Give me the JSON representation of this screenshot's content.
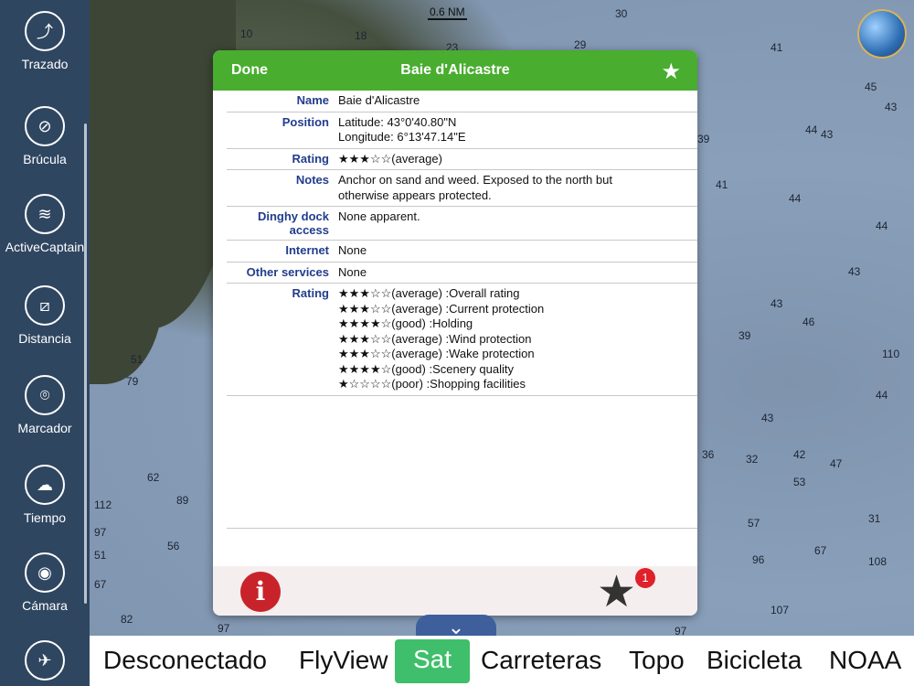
{
  "sidebar": {
    "items": [
      {
        "icon": "route-icon",
        "glyph": "⤴",
        "label": "Trazado"
      },
      {
        "icon": "compass-icon",
        "glyph": "⊘",
        "label": "Brúcula"
      },
      {
        "icon": "activecaptain-icon",
        "glyph": "≋",
        "label": "ActiveCaptain"
      },
      {
        "icon": "ruler-icon",
        "glyph": "⧄",
        "label": "Distancia"
      },
      {
        "icon": "pin-icon",
        "glyph": "⌾",
        "label": "Marcador"
      },
      {
        "icon": "weather-icon",
        "glyph": "☁",
        "label": "Tiempo"
      },
      {
        "icon": "camera-icon",
        "glyph": "◉",
        "label": "Cámara"
      },
      {
        "icon": "satellite-icon",
        "glyph": "✈",
        "label": ""
      }
    ]
  },
  "map": {
    "scale_label": "0.6 NM",
    "depths": [
      "30",
      "10",
      "18",
      "23",
      "29",
      "41",
      "43",
      "39",
      "43",
      "41",
      "44",
      "44",
      "43",
      "43",
      "46",
      "39",
      "44",
      "43",
      "42",
      "36",
      "32",
      "53",
      "47",
      "57",
      "67",
      "31",
      "51",
      "79",
      "62",
      "89",
      "112",
      "97",
      "56",
      "51",
      "67",
      "82",
      "97",
      "97",
      "96",
      "108",
      "107",
      "110",
      "45",
      "44"
    ]
  },
  "dialog": {
    "done_label": "Done",
    "title": "Baie d'Alicastre",
    "rows": [
      {
        "key": "Name",
        "lines": [
          "Baie d'Alicastre"
        ]
      },
      {
        "key": "Position",
        "lines": [
          "Latitude: 43°0'40.80\"N",
          "Longitude: 6°13'47.14\"E"
        ]
      },
      {
        "key": "Rating",
        "lines": [
          "★★★☆☆(average)"
        ]
      },
      {
        "key": "Notes",
        "lines": [
          "Anchor on sand and weed.  Exposed to the north but",
          "otherwise appears protected."
        ]
      },
      {
        "key": "Dinghy dock access",
        "lines": [
          "None apparent."
        ]
      },
      {
        "key": "Internet",
        "lines": [
          "None"
        ]
      },
      {
        "key": "Other services",
        "lines": [
          "None"
        ]
      },
      {
        "key": "Rating",
        "lines": [
          "★★★☆☆(average) :Overall rating",
          "★★★☆☆(average) :Current protection",
          "★★★★☆(good) :Holding",
          "★★★☆☆(average) :Wind protection",
          "★★★☆☆(average) :Wake protection",
          "★★★★☆(good) :Scenery quality",
          "★☆☆☆☆(poor) :Shopping facilities"
        ]
      }
    ],
    "info_glyph": "i",
    "favorites_badge": "1"
  },
  "layers": {
    "handle_glyph": "⌄",
    "items": [
      "Desconectado",
      "FlyView",
      "Sat",
      "Carreteras",
      "Topo",
      "Bicicleta",
      "NOAA"
    ],
    "active": "Sat"
  },
  "colors": {
    "header_green": "#49ad30",
    "key_blue": "#213d8c",
    "sidebar": "#2f4661",
    "active_layer": "#3fbf6b"
  }
}
